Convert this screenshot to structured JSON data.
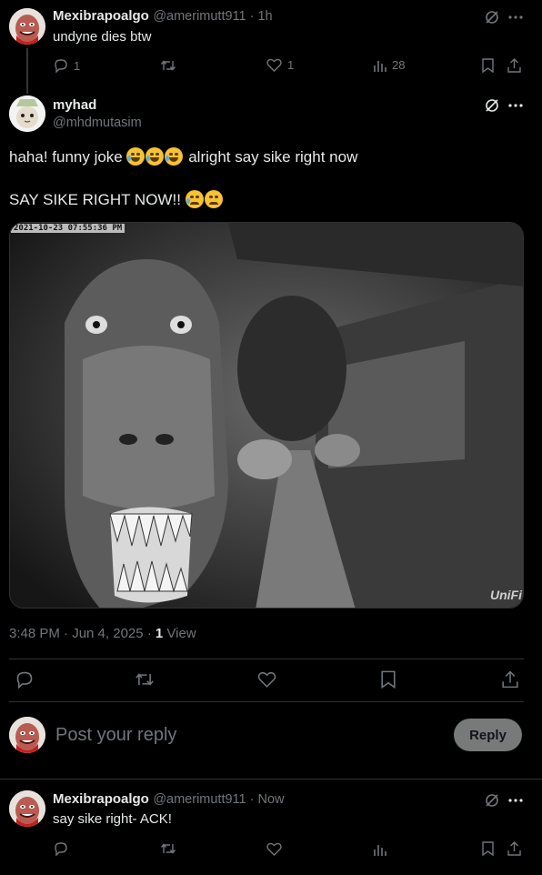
{
  "reply1": {
    "name": "Mexibrapoalgo",
    "handle_time": "@amerimutt911 · 1h",
    "text": "undyne dies btw",
    "replies": "1",
    "reposts": "",
    "likes": "1",
    "views": "28"
  },
  "main": {
    "name": "myhad",
    "handle": "@mhdmutasim",
    "line1_before": "haha! funny joke ",
    "line1_after": " alright say sike right now",
    "line2": "SAY SIKE RIGHT NOW!! ",
    "image_timestamp": "2021-10-23 07:55:36 PM",
    "image_watermark": "UniFi",
    "meta_time": "3:48 PM · Jun 4, 2025 · ",
    "views_count": "1",
    "views_label": " View"
  },
  "composer": {
    "placeholder": "Post your reply",
    "button": "Reply"
  },
  "reply2": {
    "name": "Mexibrapoalgo",
    "handle_time": "@amerimutt911 · Now",
    "text": "say sike right- ACK!"
  },
  "colors": {
    "background": "#000000",
    "text": "#e7e9ea",
    "muted": "#71767b",
    "divider": "#2f3336"
  }
}
